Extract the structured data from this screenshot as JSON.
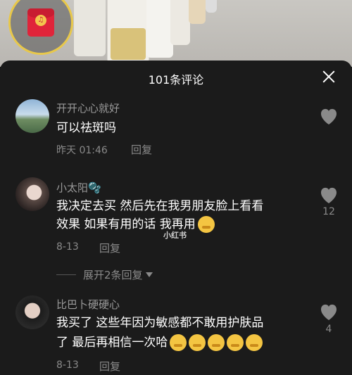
{
  "video": {
    "redpacket_icon": "red-envelope-icon"
  },
  "header": {
    "title": "101条评论",
    "close_icon": "close-icon"
  },
  "comments": [
    {
      "username": "开开心心就好",
      "text": "可以祛斑吗",
      "time": "昨天 01:46",
      "reply_label": "回复",
      "likes": ""
    },
    {
      "username": "小太阳🫧",
      "text_line1": "我决定去买 然后先在我男朋友脸上看看",
      "text_line2": "效果 如果有用的话 我再用",
      "time": "8-13",
      "reply_label": "回复",
      "likes": "12"
    },
    {
      "username": "比巴卜硬硬心",
      "text_line1": "我买了 这些年因为敏感都不敢用护肤品",
      "text_line2": "了 最后再相信一次哈",
      "time": "8-13",
      "reply_label": "回复",
      "likes": "4"
    }
  ],
  "expand_replies": "展开2条回复",
  "watermark": "小红书",
  "colors": {
    "accent_ring": "#e8c84a",
    "redpacket": "#e0243a",
    "sheet_bg": "#1b1b1b"
  }
}
